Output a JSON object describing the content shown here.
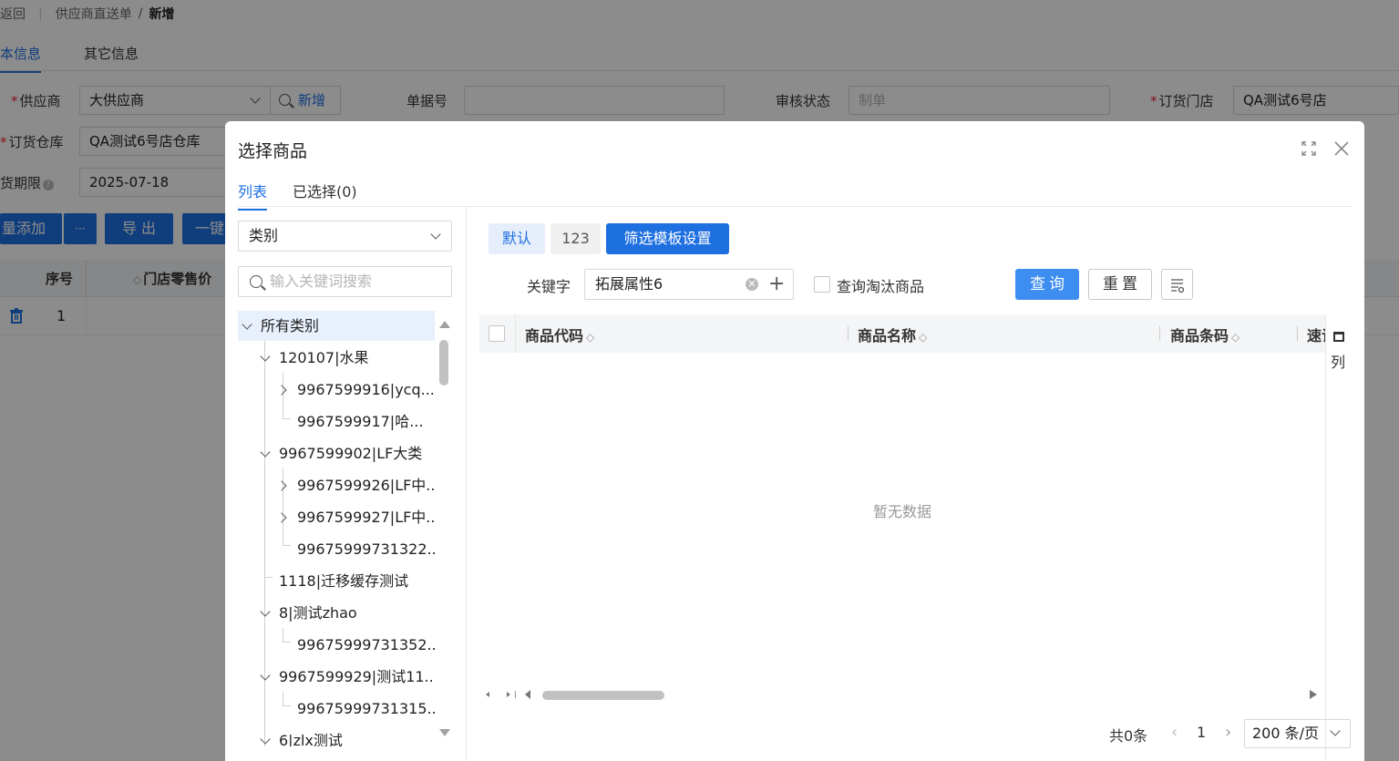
{
  "breadcrumb": {
    "back": "返回",
    "parent": "供应商直送单",
    "separator": "/",
    "current": "新增"
  },
  "page_tabs": [
    "本信息",
    "其它信息"
  ],
  "form": {
    "supplier": {
      "label": "供应商",
      "value": "大供应商",
      "add_label": "新增"
    },
    "doc_no": {
      "label": "单据号",
      "value": ""
    },
    "audit_status": {
      "label": "审核状态",
      "placeholder": "制单"
    },
    "order_store": {
      "label": "订货门店",
      "value": "QA测试6号店"
    },
    "warehouse": {
      "label": "订货仓库",
      "value": "QA测试6号店仓库"
    },
    "delivery_deadline": {
      "label": "货期限",
      "value": "2025-07-18"
    }
  },
  "bg_actions": {
    "batch_add": "量添加",
    "more": "···",
    "export": "导 出",
    "one_key": "一键"
  },
  "bg_table": {
    "headers": [
      "序号",
      "门店零售价"
    ],
    "row_index": "1"
  },
  "modal": {
    "title": "选择商品",
    "tabs": {
      "list": "列表",
      "selected": "已选择(0)"
    },
    "category_select": "类别",
    "search_placeholder": "输入关键词搜索",
    "tree": [
      {
        "label": "所有类别",
        "level": 0,
        "arrow": "down"
      },
      {
        "label": "120107|水果",
        "level": 1,
        "arrow": "down"
      },
      {
        "label": "9967599916|ycq...",
        "level": 2,
        "arrow": "right"
      },
      {
        "label": "9967599917|哈...",
        "level": 2,
        "arrow": "none"
      },
      {
        "label": "9967599902|LF大类",
        "level": 1,
        "arrow": "down"
      },
      {
        "label": "9967599926|LF中...",
        "level": 2,
        "arrow": "right"
      },
      {
        "label": "9967599927|LF中...",
        "level": 2,
        "arrow": "right"
      },
      {
        "label": "99675999731322...",
        "level": 2,
        "arrow": "none"
      },
      {
        "label": "1118|迁移缓存测试",
        "level": 1,
        "arrow": "none"
      },
      {
        "label": "8|测试zhao",
        "level": 1,
        "arrow": "down"
      },
      {
        "label": "99675999731352...",
        "level": 2,
        "arrow": "none"
      },
      {
        "label": "9967599929|测试11...",
        "level": 1,
        "arrow": "down"
      },
      {
        "label": "99675999731315...",
        "level": 2,
        "arrow": "none"
      },
      {
        "label": "6|zlx测试",
        "level": 1,
        "arrow": "down"
      }
    ],
    "filter_pills": [
      "默认",
      "123",
      "筛选模板设置"
    ],
    "keyword_label": "关键字",
    "keyword_value": "拓展属性6",
    "include_obsolete_label": "查询淘汰商品",
    "query_label": "查询",
    "reset_label": "重置",
    "columns": [
      "商品代码",
      "商品名称",
      "商品条码",
      "速记"
    ],
    "column_panel_label": "列",
    "empty_text": "暂无数据",
    "pager": {
      "total": "共0条",
      "page": "1",
      "page_size": "200 条/页"
    }
  },
  "colors": {
    "primary": "#1e6fe0",
    "query_button": "#3d8ef0"
  }
}
